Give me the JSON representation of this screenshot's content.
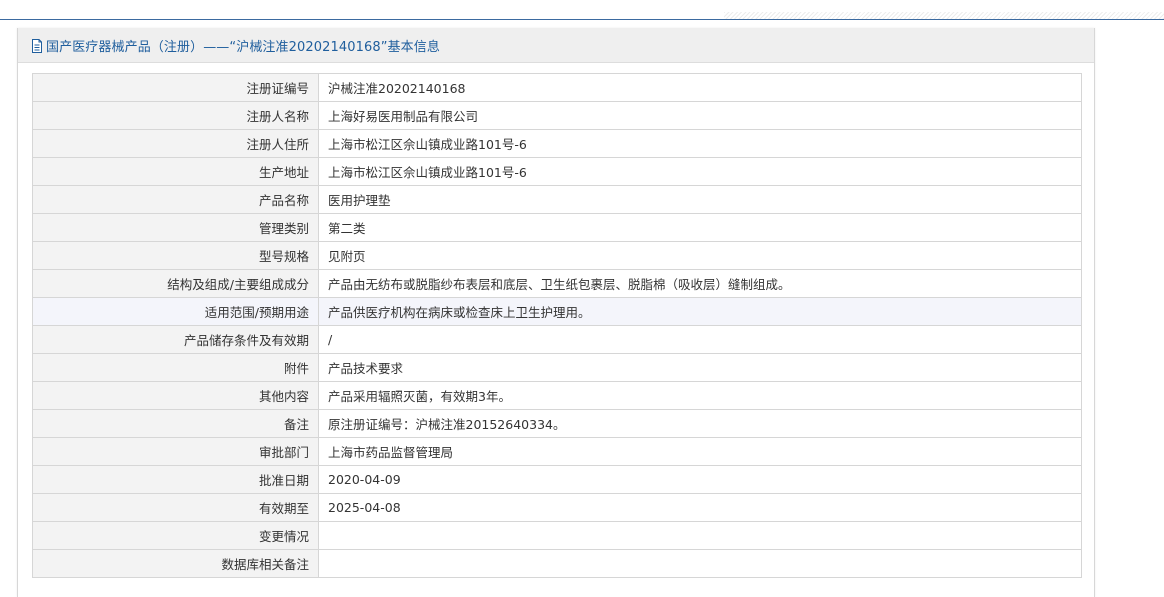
{
  "page": {
    "title": "国产医疗器械产品（注册）——“沪械注准20202140168”基本信息"
  },
  "table": {
    "rows": [
      {
        "label": "注册证编号",
        "value": "沪械注准20202140168"
      },
      {
        "label": "注册人名称",
        "value": "上海好易医用制品有限公司"
      },
      {
        "label": "注册人住所",
        "value": "上海市松江区佘山镇成业路101号-6"
      },
      {
        "label": "生产地址",
        "value": "上海市松江区佘山镇成业路101号-6"
      },
      {
        "label": "产品名称",
        "value": "医用护理垫"
      },
      {
        "label": "管理类别",
        "value": "第二类"
      },
      {
        "label": "型号规格",
        "value": "见附页"
      },
      {
        "label": "结构及组成/主要组成成分",
        "value": "产品由无纺布或脱脂纱布表层和底层、卫生纸包裹层、脱脂棉（吸收层）缝制组成。"
      },
      {
        "label": "适用范围/预期用途",
        "value": "产品供医疗机构在病床或检查床上卫生护理用。"
      },
      {
        "label": "产品储存条件及有效期",
        "value": "/"
      },
      {
        "label": "附件",
        "value": "产品技术要求"
      },
      {
        "label": "其他内容",
        "value": "产品采用辐照灭菌，有效期3年。"
      },
      {
        "label": "备注",
        "value": "原注册证编号：沪械注准20152640334。"
      },
      {
        "label": "审批部门",
        "value": "上海市药品监督管理局"
      },
      {
        "label": "批准日期",
        "value": "2020-04-09"
      },
      {
        "label": "有效期至",
        "value": "2025-04-08"
      },
      {
        "label": "变更情况",
        "value": ""
      },
      {
        "label": "数据库相关备注",
        "value": ""
      }
    ]
  },
  "icons": {
    "title_icon": "document-icon"
  },
  "colors": {
    "title_text": "#1f5e9d",
    "header_bg": "#efefef",
    "label_bg": "#f3f3f3",
    "highlight_row_bg": "#f4f5fb",
    "border": "#d6d6d6"
  }
}
